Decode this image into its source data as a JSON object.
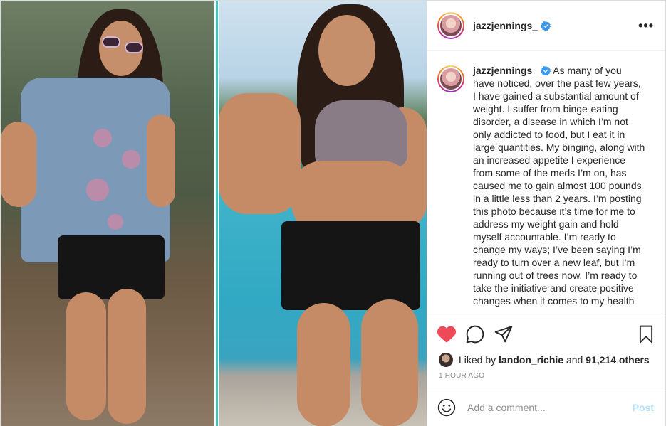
{
  "post": {
    "author": "jazzjennings_",
    "verified": true,
    "more_icon": "more-horizontal-icon",
    "caption": "As many of you have noticed, over the past few years, I have gained a substantial amount of weight. I suffer from binge-eating disorder, a disease in which I’m not only addicted to food, but I eat it in large quantities. My binging, along with an increased appetite I experience from some of the meds I’m on, has caused me to gain almost 100 pounds in a little less than 2 years. I’m posting this photo because it’s time for me to address my weight gain and hold myself accountable. I’m ready to change my ways; I’ve been saying I’m ready to turn over a new leaf, but I’m running out of trees now. I’m ready to take the initiative and create positive changes when it comes to my health",
    "liked_by_prefix": "Liked by",
    "liked_by_user": "landon_richie",
    "liked_by_and": "and",
    "likes_others": "91,214 others",
    "timestamp": "1 HOUR AGO"
  },
  "actions": {
    "like_icon": "heart-filled-icon",
    "comment_icon": "comment-icon",
    "share_icon": "send-icon",
    "save_icon": "bookmark-icon",
    "like_color": "#ed4956"
  },
  "comment": {
    "placeholder": "Add a comment...",
    "post_label": "Post",
    "emoji_icon": "emoji-icon"
  },
  "colors": {
    "verified_blue": "#3897f0",
    "post_button_disabled": "#b2dffc",
    "divider_teal": "#36c7c0"
  }
}
